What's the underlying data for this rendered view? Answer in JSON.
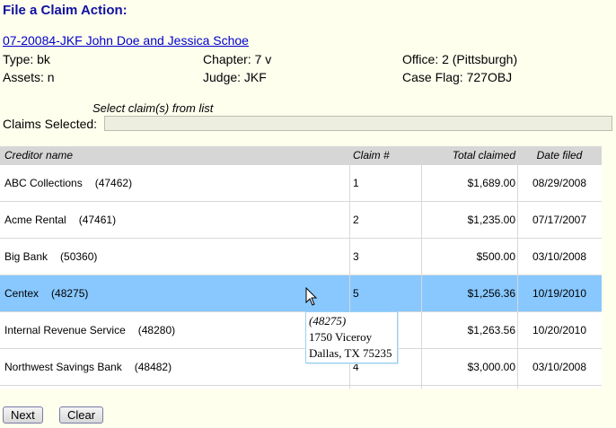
{
  "page": {
    "title": "File a Claim Action:",
    "case_link": "07-20084-JKF John Doe and Jessica Schoe"
  },
  "case_info": {
    "type": "Type: bk",
    "chapter": "Chapter: 7 v",
    "office": "Office: 2 (Pittsburgh)",
    "assets": "Assets: n",
    "judge": "Judge: JKF",
    "case_flag": "Case Flag: 727OBJ"
  },
  "claims": {
    "select_hint": "Select claim(s) from list",
    "selected_label": "Claims Selected:",
    "selected_value": ""
  },
  "table": {
    "headers": [
      "Creditor name",
      "Claim #",
      "Total claimed",
      "Date filed"
    ],
    "rows": [
      {
        "creditor": "ABC Collections",
        "id": "(47462)",
        "claim": "1",
        "total": "$1,689.00",
        "date": "08/29/2008"
      },
      {
        "creditor": "Acme Rental",
        "id": "(47461)",
        "claim": "2",
        "total": "$1,235.00",
        "date": "07/17/2007"
      },
      {
        "creditor": "Big Bank",
        "id": "(50360)",
        "claim": "3",
        "total": "$500.00",
        "date": "03/10/2008"
      },
      {
        "creditor": "Centex",
        "id": "(48275)",
        "claim": "5",
        "total": "$1,256.36",
        "date": "10/19/2010"
      },
      {
        "creditor": "Internal Revenue Service",
        "id": "(48280)",
        "claim": "",
        "total": "$1,263.56",
        "date": "10/20/2010"
      },
      {
        "creditor": "Northwest Savings Bank",
        "id": "(48482)",
        "claim": "4",
        "total": "$3,000.00",
        "date": "03/10/2008"
      }
    ]
  },
  "tooltip": {
    "id": "(48275)",
    "line1": "1750 Viceroy",
    "line2": "Dallas, TX 75235"
  },
  "buttons": {
    "next": "Next",
    "clear": "Clear"
  },
  "colors": {
    "title": "#1010a0",
    "selected_row": "#88c8ff",
    "background": "#ffffee"
  }
}
